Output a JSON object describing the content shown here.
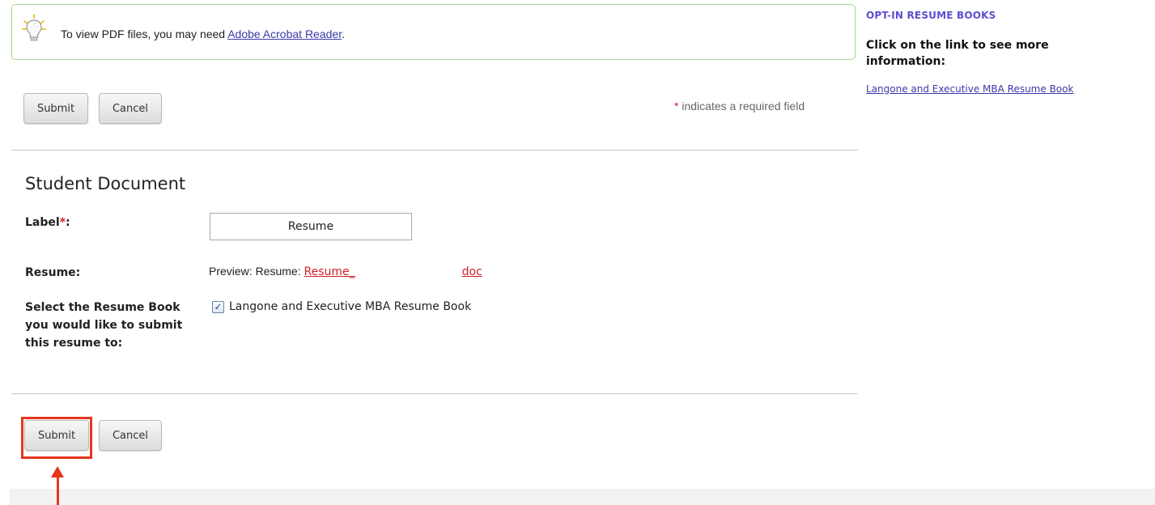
{
  "info": {
    "text": "To view PDF files, you may need ",
    "link": "Adobe Acrobat Reader",
    "trailing": "."
  },
  "buttons": {
    "submit": "Submit",
    "cancel": "Cancel"
  },
  "required_note": {
    "star": "*",
    "text": " indicates a required field"
  },
  "section": {
    "title": "Student Document"
  },
  "form": {
    "label_field": {
      "label": "Label",
      "star": "*",
      "colon": ":",
      "value": "Resume"
    },
    "resume_field": {
      "label": "Resume:",
      "preview_prefix": "Preview: Resume: ",
      "link_start": "Resume_",
      "link_end": "doc"
    },
    "resume_book_field": {
      "label": "Select the Resume Book you would like to submit this resume to:",
      "option_label": "Langone and Executive MBA Resume Book",
      "checked": true
    }
  },
  "sidebar": {
    "heading": "OPT-IN RESUME BOOKS",
    "subheading": "Click on the link to see more information:",
    "link": "Langone and Executive MBA Resume Book"
  },
  "colors": {
    "accent_red": "#d0202a",
    "annotation_red": "#e8361c",
    "link_blue": "#3a3aa8",
    "sidebar_purple": "#5b4fcf",
    "info_border_green": "#9edc8a"
  },
  "icons": {
    "info": "lightbulb-icon",
    "checkbox": "checkmark-icon",
    "annotation": "up-arrow-icon"
  }
}
